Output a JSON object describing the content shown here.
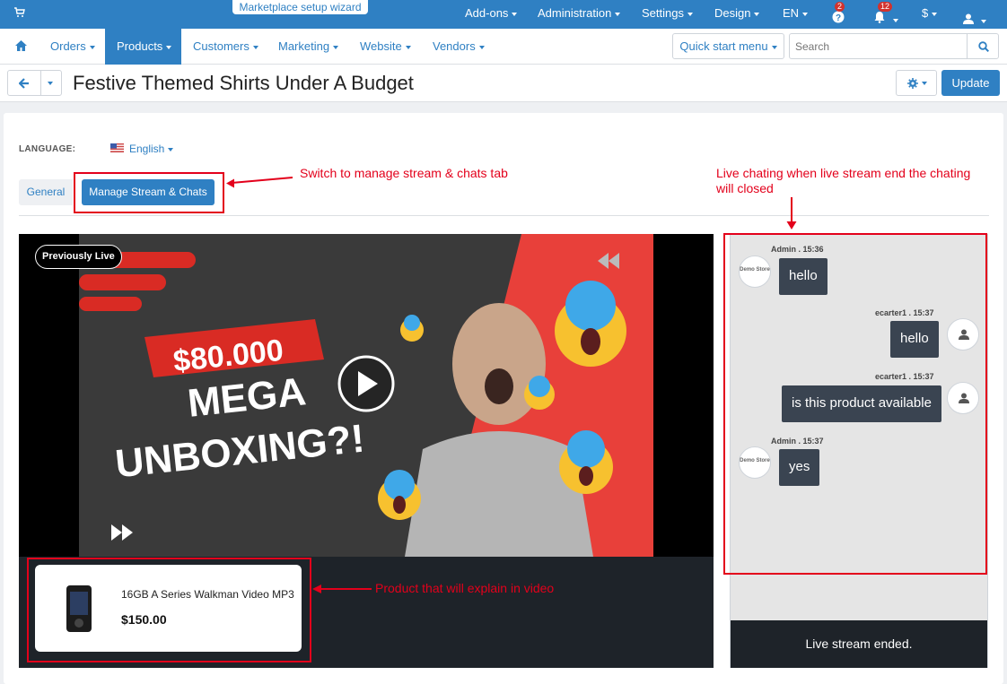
{
  "topbar": {
    "wizard_label": "Marketplace setup wizard",
    "menus": [
      "Add-ons",
      "Administration",
      "Settings",
      "Design",
      "EN"
    ],
    "help_badge": "2",
    "notifications_badge": "12",
    "currency": "$"
  },
  "nav": {
    "tabs": [
      "Orders",
      "Products",
      "Customers",
      "Marketing",
      "Website",
      "Vendors"
    ],
    "active_tab": "Products",
    "quick_start": "Quick start menu",
    "search_placeholder": "Search"
  },
  "page": {
    "title": "Festive Themed Shirts Under A Budget",
    "update_label": "Update"
  },
  "language": {
    "label": "LANGUAGE:",
    "value": "English"
  },
  "tabs": {
    "general": "General",
    "manage": "Manage Stream & Chats"
  },
  "annotations": {
    "switch_tab": "Switch to manage stream & chats tab",
    "live_chat": "Live chating when live stream end the chating will closed",
    "product": "Product that will explain in video"
  },
  "video": {
    "badge": "Previously Live",
    "price_text": "$80.000",
    "headline_1": "MEGA",
    "headline_2": "UNBOXING?!"
  },
  "product": {
    "name": "16GB A Series Walkman Video MP3",
    "price": "$150.00"
  },
  "chat": {
    "messages": [
      {
        "meta": "Admin . 15:36",
        "text": "hello",
        "side": "left",
        "avatar": "Demo Store"
      },
      {
        "meta": "ecarter1 . 15:37",
        "text": "hello",
        "side": "right"
      },
      {
        "meta": "ecarter1 . 15:37",
        "text": "is this product available",
        "side": "right"
      },
      {
        "meta": "Admin . 15:37",
        "text": "yes",
        "side": "left",
        "avatar": "Demo Store"
      }
    ],
    "ended": "Live stream ended."
  },
  "colors": {
    "primary": "#2f80c3",
    "annotation_red": "#e3001b",
    "dark_panel": "#1e2329"
  }
}
